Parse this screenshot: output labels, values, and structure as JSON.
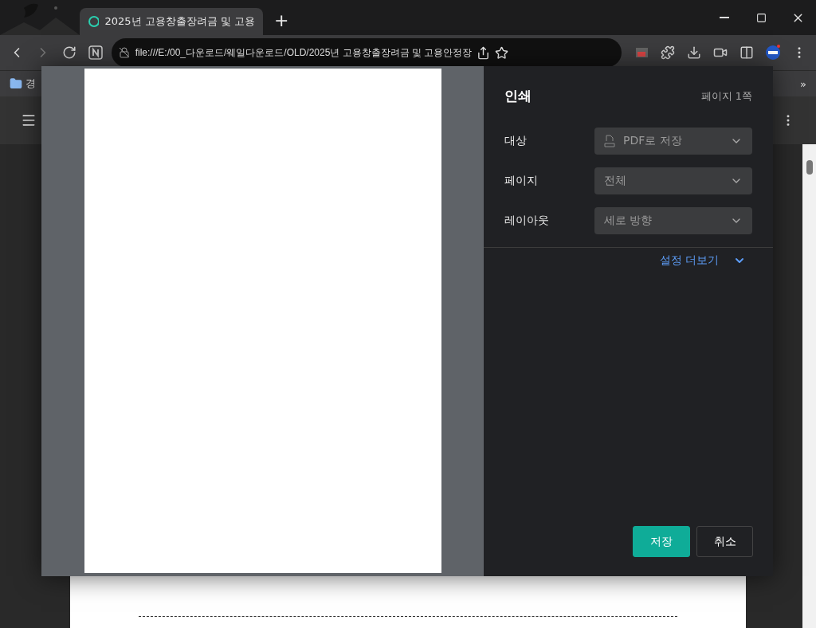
{
  "tab": {
    "title": "2025년 고용창출장려금 및 고용",
    "selected": true
  },
  "new_tab": "+",
  "address_bar": {
    "url": "file:///E:/00_다운로드/웨일다운로드/OLD/2025년 고용창출장려금 및 고용안정장"
  },
  "bookmarks": [
    {
      "label": "경"
    }
  ],
  "bookmarks_more": "»",
  "print_dialog": {
    "title": "인쇄",
    "page_count": "페이지 1쪽",
    "settings": [
      {
        "label": "대상",
        "value": "PDF로 저장",
        "kind": "pdf"
      },
      {
        "label": "페이지",
        "value": "전체",
        "kind": "plain"
      },
      {
        "label": "레이아웃",
        "value": "세로 방향",
        "kind": "plain"
      }
    ],
    "more_settings": "설정 더보기",
    "buttons": [
      {
        "label": "저장",
        "primary": true
      },
      {
        "label": "취소",
        "primary": false
      }
    ]
  }
}
